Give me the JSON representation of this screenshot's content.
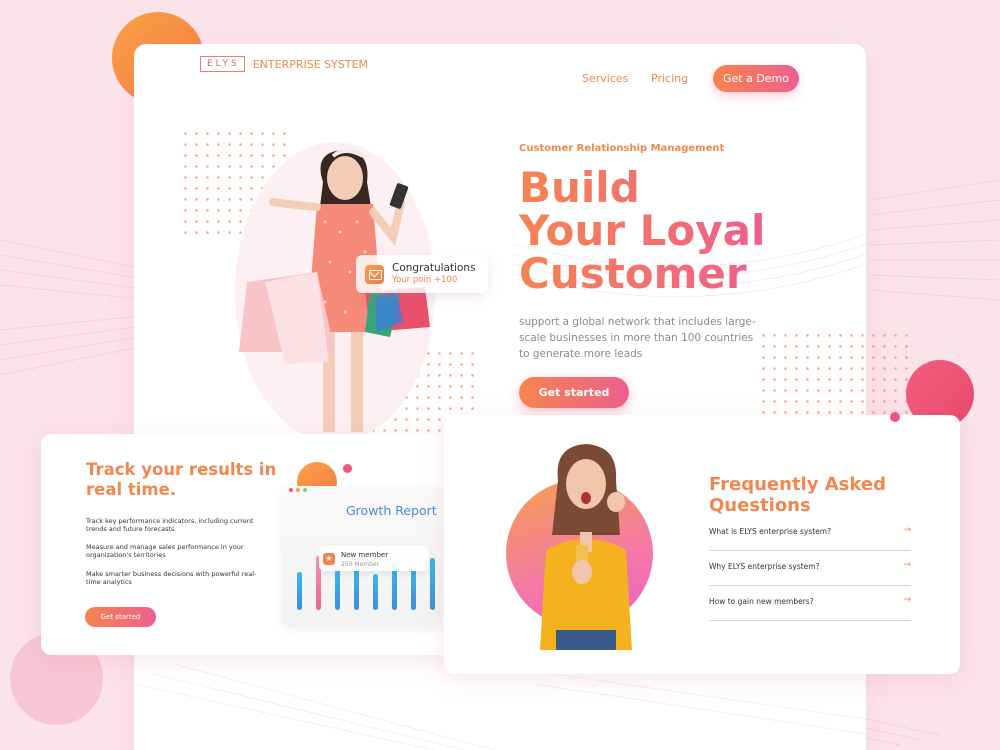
{
  "brand": {
    "logo": "ELYS",
    "name": "ENTERPRISE SYSTEM"
  },
  "nav": {
    "services": "Services",
    "pricing": "Pricing",
    "demo": "Get a Demo"
  },
  "hero": {
    "eyebrow": "Customer Relationship Management",
    "headline": [
      "Build",
      "Your Loyal",
      "Customer"
    ],
    "subtext": "support a global network that includes large-scale businesses in more than 100 countries to generate more leads",
    "cta": "Get started"
  },
  "notification": {
    "title": "Congratulations",
    "subtitle": "Your poin +100"
  },
  "results_card": {
    "title": "Track your results in real time.",
    "items": [
      "Track key performance indicators, including current trends and future forecasts",
      "Measure and manage sales performance in your organization's territories",
      "Make smarter business decisions with powerful real-time analytics"
    ],
    "cta": "Get started",
    "report": {
      "title": "Growth Report",
      "member_title": "New member",
      "member_sub": "250 Member"
    }
  },
  "faq": {
    "title": "Frequently Asked Questions",
    "questions": [
      "What is ELYS enterprise system?",
      "Why ELYS enterprise system?",
      "How to gain new members?"
    ]
  },
  "colors": {
    "orange": "#f0874f",
    "pink": "#ee5f8e",
    "blue": "#4a8ad9",
    "background": "#fbe3ea"
  },
  "icons": {
    "mail": "mail-icon",
    "star": "star-icon",
    "arrow": "arrow-right-icon"
  }
}
